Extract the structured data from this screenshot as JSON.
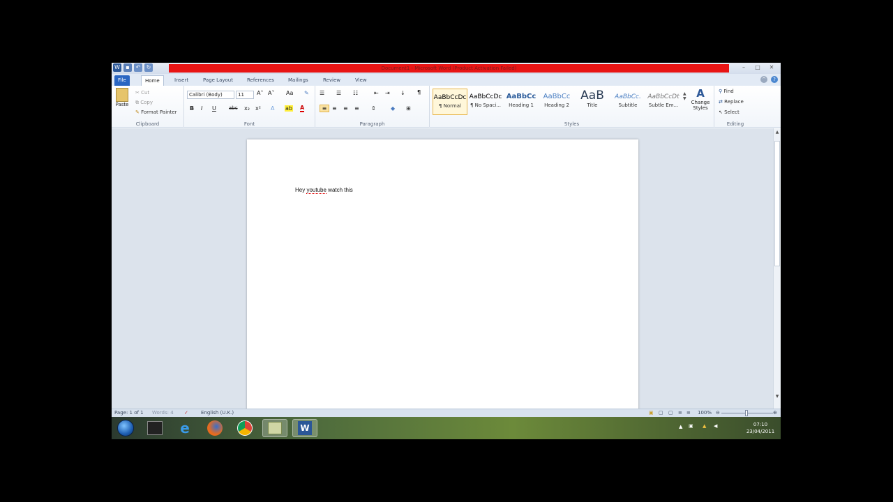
{
  "window": {
    "title": "Document1 - Microsoft Word (Product Activation Failed)",
    "minimize": "–",
    "maximize": "□",
    "close": "✕"
  },
  "tabs": [
    "File",
    "Home",
    "Insert",
    "Page Layout",
    "References",
    "Mailings",
    "Review",
    "View"
  ],
  "clipboard": {
    "paste": "Paste",
    "cut": "Cut",
    "copy": "Copy",
    "format_painter": "Format Painter",
    "label": "Clipboard"
  },
  "font": {
    "family": "Calibri (Body)",
    "size": "11",
    "bold": "B",
    "italic": "I",
    "underline": "U",
    "strike": "abc",
    "subscript": "x₂",
    "superscript": "x²",
    "grow": "A˄",
    "shrink": "A˅",
    "change_case": "Aa",
    "highlight": "ab",
    "font_color": "A",
    "label": "Font"
  },
  "paragraph": {
    "label": "Paragraph",
    "pilcrow": "¶"
  },
  "styles": {
    "label": "Styles",
    "items": [
      {
        "sample": "AaBbCcDc",
        "name": "¶ Normal"
      },
      {
        "sample": "AaBbCcDc",
        "name": "¶ No Spaci..."
      },
      {
        "sample": "AaBbCc",
        "name": "Heading 1"
      },
      {
        "sample": "AaBbCc",
        "name": "Heading 2"
      },
      {
        "sample": "AaB",
        "name": "Title"
      },
      {
        "sample": "AaBbCc.",
        "name": "Subtitle"
      },
      {
        "sample": "AaBbCcDt",
        "name": "Subtle Em..."
      }
    ],
    "change_styles": "Change Styles"
  },
  "editing": {
    "label": "Editing",
    "find": "Find",
    "replace": "Replace",
    "select": "Select"
  },
  "document": {
    "text_word1": "Hey",
    "text_word2": "youtube",
    "text_rest": "watch this"
  },
  "status": {
    "page": "Page: 1 of 1",
    "words": "Words: 4",
    "language": "English (U.K.)",
    "zoom": "100%",
    "zoom_level": 1.0
  },
  "taskbar": {
    "time": "07:10",
    "date": "23/04/2011"
  },
  "colors": {
    "title_highlight": "#e81414",
    "file_tab": "#2a66c2"
  }
}
